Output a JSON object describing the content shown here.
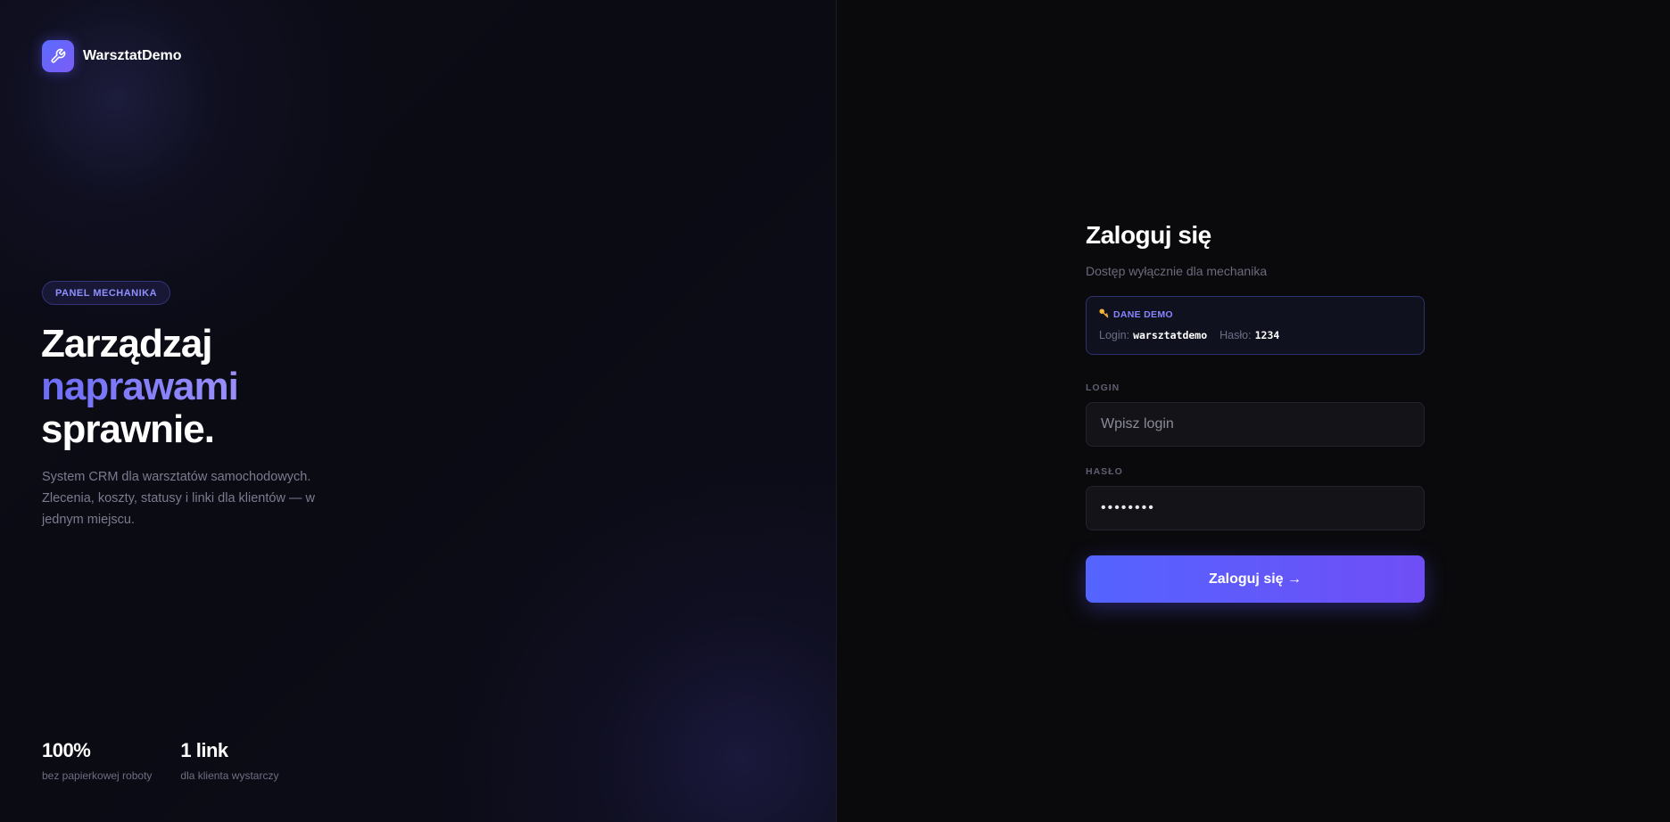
{
  "brand": {
    "name": "WarsztatDemo",
    "icon": "wrench-icon"
  },
  "hero": {
    "badge": "PANEL MECHANIKA",
    "headline_line1": "Zarządzaj",
    "headline_line2": "naprawami",
    "headline_line3": "sprawnie.",
    "description": "System CRM dla warsztatów samochodowych. Zlecenia, koszty, statusy i linki dla klientów — w jednym miejscu."
  },
  "stats": [
    {
      "value": "100%",
      "label": "bez papierkowej roboty"
    },
    {
      "value": "1 link",
      "label": "dla klienta wystarczy"
    }
  ],
  "login": {
    "title": "Zaloguj się",
    "subtitle": "Dostęp wyłącznie dla mechanika",
    "demo": {
      "icon": "key-icon",
      "heading": "DANE DEMO",
      "login_label": "Login:",
      "login_value": "warsztatdemo",
      "password_label": "Hasło:",
      "password_value": "1234"
    },
    "login_field": {
      "label": "LOGIN",
      "placeholder": "Wpisz login",
      "value": ""
    },
    "password_field": {
      "label": "HASŁO",
      "value": "••••••••"
    },
    "submit_label": "Zaloguj się →"
  },
  "colors": {
    "accent_start": "#5464ff",
    "accent_end": "#6f4ef6",
    "badge_text": "#8e8fff",
    "background": "#0a0a0d"
  }
}
